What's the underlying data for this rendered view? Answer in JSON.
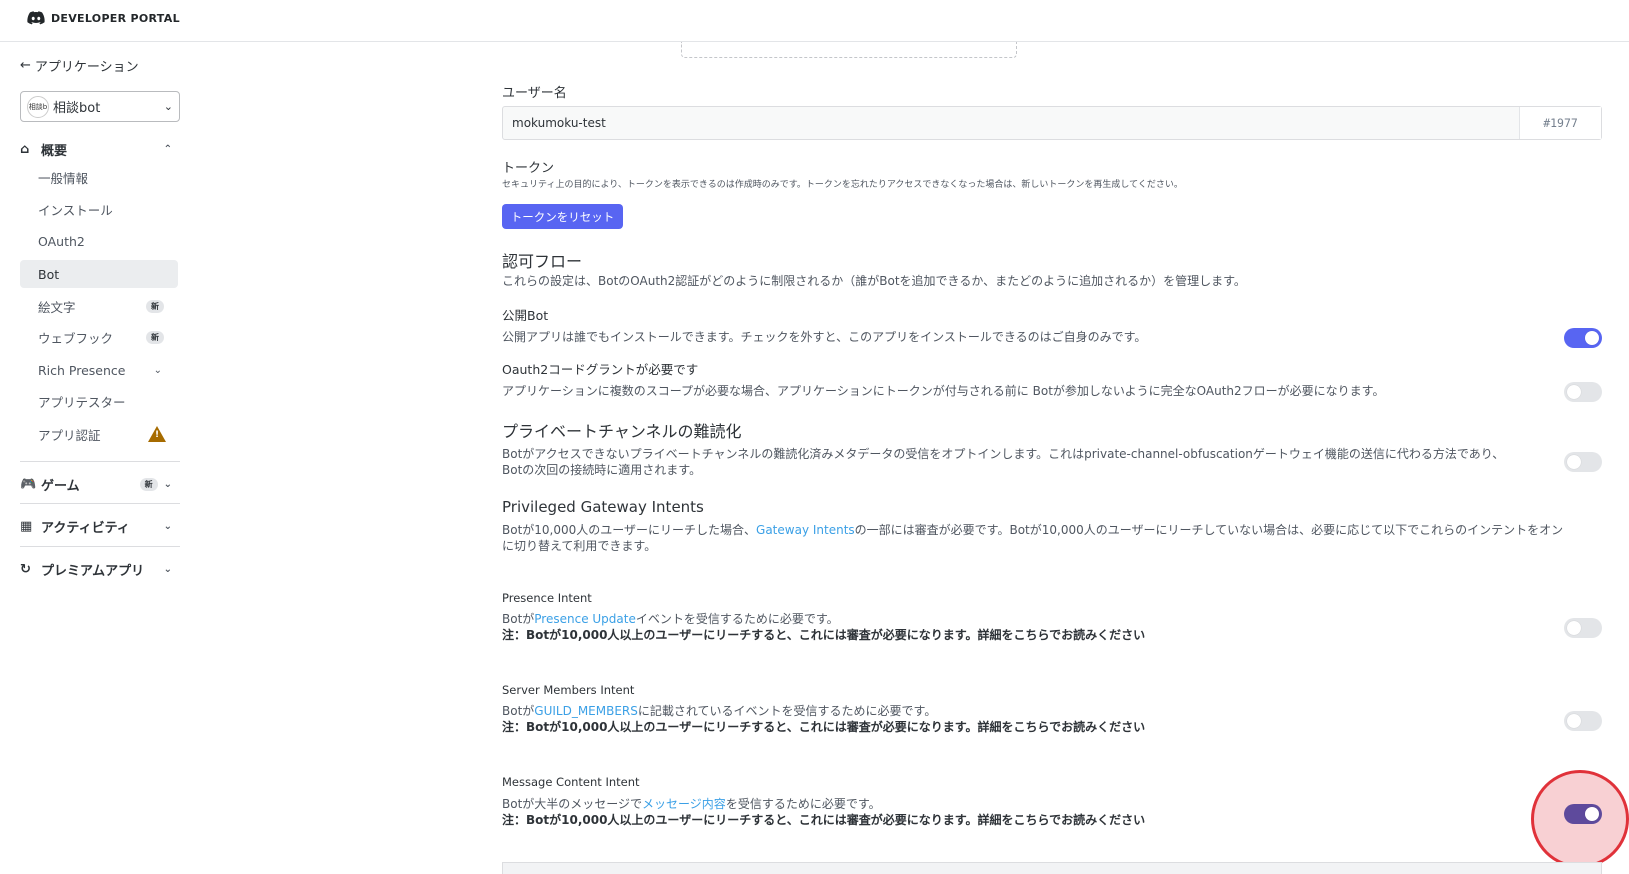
{
  "topbar": {
    "brand": "DEVELOPER PORTAL"
  },
  "sidebar": {
    "back_label": "アプリケーション",
    "app_select": {
      "avatar_text": "相談b",
      "value": "相談bot"
    },
    "sections": {
      "overview": "概要",
      "games": "ゲーム",
      "games_badge": "新",
      "activities": "アクティビティ",
      "premium": "プレミアムアプリ"
    },
    "items": [
      {
        "label": "一般情報"
      },
      {
        "label": "インストール"
      },
      {
        "label": "OAuth2"
      },
      {
        "label": "Bot"
      },
      {
        "label": "絵文字",
        "badge": "新"
      },
      {
        "label": "ウェブフック",
        "badge": "新"
      },
      {
        "label": "Rich Presence"
      },
      {
        "label": "アプリテスター"
      },
      {
        "label": "アプリ認証"
      }
    ]
  },
  "main": {
    "username_label": "ユーザー名",
    "username_value": "mokumoku-test",
    "discriminator": "#1977",
    "token_label": "トークン",
    "token_desc": "セキュリティ上の目的により、トークンを表示できるのは作成時のみです。トークンを忘れたりアクセスできなくなった場合は、新しいトークンを再生成してください。",
    "reset_button": "トークンをリセット",
    "auth_flow": {
      "title": "認可フロー",
      "desc": "これらの設定は、BotのOAuth2認証がどのように制限されるか（誰がBotを追加できるか、またどのように追加されるか）を管理します。"
    },
    "public_bot": {
      "label": "公開Bot",
      "desc": "公開アプリは誰でもインストールできます。チェックを外すと、このアプリをインストールできるのはご自身のみです。"
    },
    "oauth_grant": {
      "label": "Oauth2コードグラントが必要です",
      "desc": "アプリケーションに複数のスコープが必要な場合、アプリケーションにトークンが付与される前に Botが参加しないように完全なOAuth2フローが必要になります。"
    },
    "private_channel": {
      "title": "プライベートチャンネルの難読化",
      "desc1": "Botがアクセスできないプライベートチャンネルの難読化済みメタデータの受信をオプトインします。これはprivate-channel-obfuscationゲートウェイ機能の送信に代わる方法であり、",
      "desc2": "Botの次回の接続時に適用されます。"
    },
    "privileged": {
      "title": "Privileged Gateway Intents",
      "desc_a": "Botが10,000人のユーザーにリーチした場合、",
      "desc_link": "Gateway Intents",
      "desc_b": "の一部には審査が必要です。Botが10,000人のユーザーにリーチしていない場合は、必要に応じて以下でこれらのインテントをオン",
      "desc_c": "に切り替えて利用できます。"
    },
    "note_prefix": "注：Botが10,000人以上のユーザーにリーチすると、これには審査が必要になります。",
    "note_link": "詳細をこちらでお読みください",
    "presence": {
      "label": "Presence Intent",
      "a": "Botが",
      "link": "Presence Update",
      "b": "イベントを受信するために必要です。"
    },
    "members": {
      "label": "Server Members Intent",
      "a": "Botが",
      "link": "GUILD_MEMBERS",
      "b": "に記載されているイベントを受信するために必要です。"
    },
    "message": {
      "label": "Message Content Intent",
      "a": "Botが大半のメッセージで",
      "link": "メッセージ内容",
      "b": "を受信するために必要です。"
    }
  },
  "toggles": {
    "public_bot": true,
    "oauth_grant": false,
    "private_channel": false,
    "presence": false,
    "members": false,
    "message_content": true
  }
}
